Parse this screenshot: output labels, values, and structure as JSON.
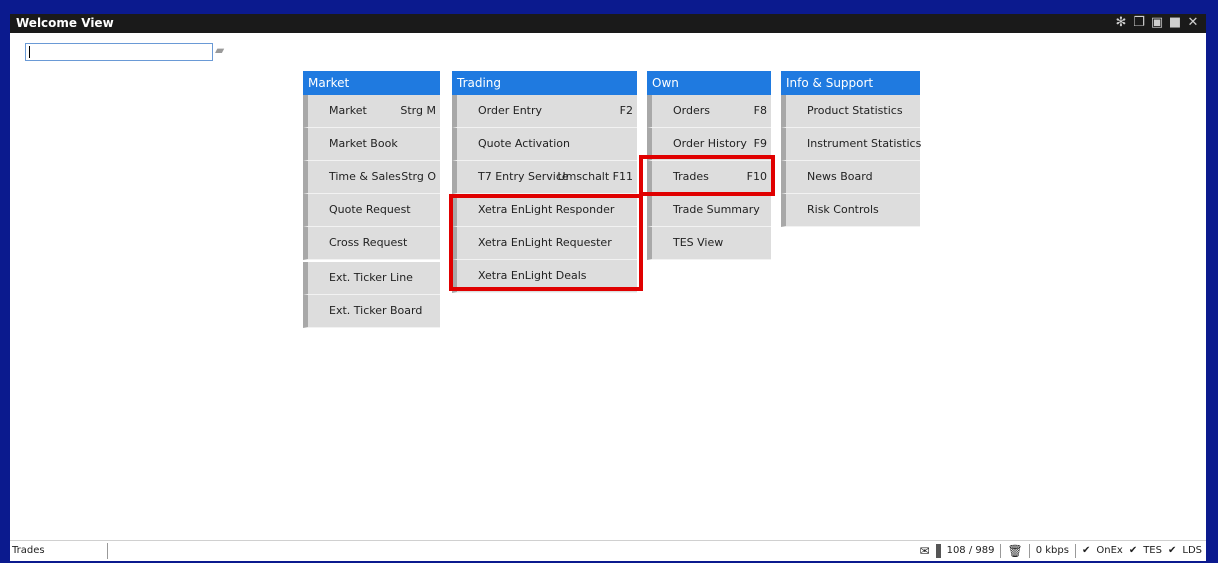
{
  "window": {
    "title": "Welcome View"
  },
  "title_icons": [
    "gear-icon",
    "restore-icon",
    "tile-icon",
    "maximize-icon",
    "close-icon"
  ],
  "search": {
    "value": "",
    "placeholder": ""
  },
  "menus": {
    "market": {
      "header": "Market",
      "items": [
        {
          "label": "Market",
          "shortcut": "Strg M"
        },
        {
          "label": "Market Book",
          "shortcut": ""
        },
        {
          "label": "Time & Sales",
          "shortcut": "Strg O"
        },
        {
          "label": "Quote Request",
          "shortcut": ""
        },
        {
          "label": "Cross Request",
          "shortcut": ""
        },
        {
          "label": "Ext. Ticker Line",
          "shortcut": ""
        },
        {
          "label": "Ext. Ticker Board",
          "shortcut": ""
        }
      ]
    },
    "trading": {
      "header": "Trading",
      "items": [
        {
          "label": "Order Entry",
          "shortcut": "F2"
        },
        {
          "label": "Quote Activation",
          "shortcut": ""
        },
        {
          "label": "T7 Entry Service",
          "shortcut": "Umschalt F11"
        },
        {
          "label": "Xetra EnLight Responder",
          "shortcut": ""
        },
        {
          "label": "Xetra EnLight Requester",
          "shortcut": ""
        },
        {
          "label": "Xetra EnLight Deals",
          "shortcut": ""
        }
      ]
    },
    "own": {
      "header": "Own",
      "items": [
        {
          "label": "Orders",
          "shortcut": "F8"
        },
        {
          "label": "Order History",
          "shortcut": "F9"
        },
        {
          "label": "Trades",
          "shortcut": "F10"
        },
        {
          "label": "Trade Summary",
          "shortcut": ""
        },
        {
          "label": "TES View",
          "shortcut": ""
        }
      ]
    },
    "info": {
      "header": "Info & Support",
      "items": [
        {
          "label": "Product Statistics",
          "shortcut": ""
        },
        {
          "label": "Instrument Statistics",
          "shortcut": ""
        },
        {
          "label": "News Board",
          "shortcut": ""
        },
        {
          "label": "Risk Controls",
          "shortcut": ""
        }
      ]
    }
  },
  "status": {
    "left": "Trades",
    "messages": "108 / 989",
    "bandwidth": "0 kbps",
    "checks": [
      "OnEx",
      "TES",
      "LDS"
    ]
  },
  "colors": {
    "header_blue": "#1f7ae0",
    "frame_blue": "#0b1a8e",
    "highlight_red": "#e00000"
  }
}
